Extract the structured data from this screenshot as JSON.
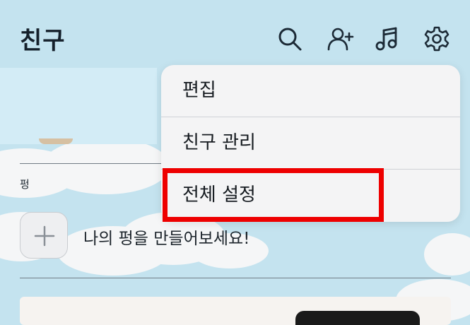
{
  "header": {
    "title": "친구",
    "icons": [
      "search-icon",
      "add-friend-icon",
      "music-icon",
      "settings-icon"
    ]
  },
  "menu": {
    "items": [
      {
        "label": "편집"
      },
      {
        "label": "친구 관리"
      },
      {
        "label": "전체 설정"
      }
    ],
    "highlighted_index": 2,
    "highlight_color": "#ee0000"
  },
  "pyeong": {
    "section_label": "펑",
    "add_prompt": "나의 펑을 만들어보세요!"
  },
  "colors": {
    "background": "#c4e3ef",
    "menu_background": "#f4f4f5",
    "text": "#15202b"
  }
}
